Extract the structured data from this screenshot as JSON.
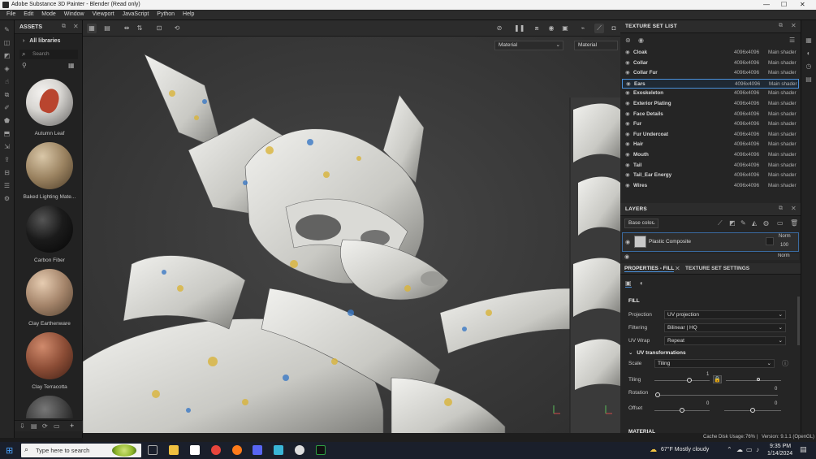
{
  "window": {
    "title": "Adobe Substance 3D Painter - Blender (Read only)",
    "controls": [
      "—",
      "☐",
      "✕"
    ]
  },
  "menu": [
    "File",
    "Edit",
    "Mode",
    "Window",
    "Viewport",
    "JavaScript",
    "Python",
    "Help"
  ],
  "assets": {
    "title": "ASSETS",
    "breadcrumb": "All libraries",
    "search_placeholder": "Search",
    "items": [
      {
        "label": "Autumn Leaf",
        "color": "#b9452f"
      },
      {
        "label": "Baked Lighting Mate...",
        "color": "#9a8260"
      },
      {
        "label": "Carbon Fiber",
        "color": "#141414"
      },
      {
        "label": "Clay Earthenware",
        "color": "#a4846a"
      },
      {
        "label": "Clay Terracotta",
        "color": "#8c4d36"
      }
    ]
  },
  "viewport": {
    "left_dropdown": "Material",
    "right_dropdown": "Material"
  },
  "texture_set_list": {
    "title": "TEXTURE SET LIST",
    "rows": [
      {
        "name": "Cloak",
        "res": "4096x4096",
        "shader": "Main shader"
      },
      {
        "name": "Collar",
        "res": "4096x4096",
        "shader": "Main shader"
      },
      {
        "name": "Collar Fur",
        "res": "4096x4096",
        "shader": "Main shader"
      },
      {
        "name": "Ears",
        "res": "4096x4096",
        "shader": "Main shader",
        "selected": true
      },
      {
        "name": "Exoskeleton",
        "res": "4096x4096",
        "shader": "Main shader"
      },
      {
        "name": "Exterior Plating",
        "res": "4096x4096",
        "shader": "Main shader"
      },
      {
        "name": "Face Details",
        "res": "4096x4096",
        "shader": "Main shader"
      },
      {
        "name": "Fur",
        "res": "4096x4096",
        "shader": "Main shader"
      },
      {
        "name": "Fur Undercoat",
        "res": "4096x4096",
        "shader": "Main shader"
      },
      {
        "name": "Hair",
        "res": "4096x4096",
        "shader": "Main shader"
      },
      {
        "name": "Mouth",
        "res": "4096x4096",
        "shader": "Main shader"
      },
      {
        "name": "Tail",
        "res": "4096x4096",
        "shader": "Main shader"
      },
      {
        "name": "Tail_Ear Energy",
        "res": "4096x4096",
        "shader": "Main shader"
      },
      {
        "name": "Wires",
        "res": "4096x4096",
        "shader": "Main shader"
      }
    ]
  },
  "layers": {
    "title": "LAYERS",
    "channel": "Base color",
    "items": [
      {
        "name": "Plastic Composite",
        "blend": "Norm",
        "opacity": "100"
      },
      {
        "name": "",
        "blend": "Norm",
        "opacity": ""
      }
    ]
  },
  "properties": {
    "tab_active": "PROPERTIES - FILL",
    "tab_other": "TEXTURE SET SETTINGS",
    "section": "FILL",
    "projection_label": "Projection",
    "projection": "UV projection",
    "filtering_label": "Filtering",
    "filtering": "Bilinear | HQ",
    "uvwrap_label": "UV Wrap",
    "uvwrap": "Repeat",
    "uv_section": "UV transformations",
    "scale_label": "Scale",
    "scale": "Tiling",
    "tiling_label": "Tiling",
    "tiling_value": "1",
    "rotation_label": "Rotation",
    "rotation_value": "0",
    "offset_label": "Offset",
    "offset_x": "0",
    "offset_y": "0",
    "material_section": "MATERIAL"
  },
  "status": {
    "cache": "Cache Disk Usage:",
    "cache_pct": "76%",
    "version": "Version: 9.1.1 (OpenGL)"
  },
  "taskbar": {
    "search": "Type here to search",
    "weather": "67°F  Mostly cloudy",
    "time": "9:35 PM",
    "date": "1/14/2024"
  }
}
